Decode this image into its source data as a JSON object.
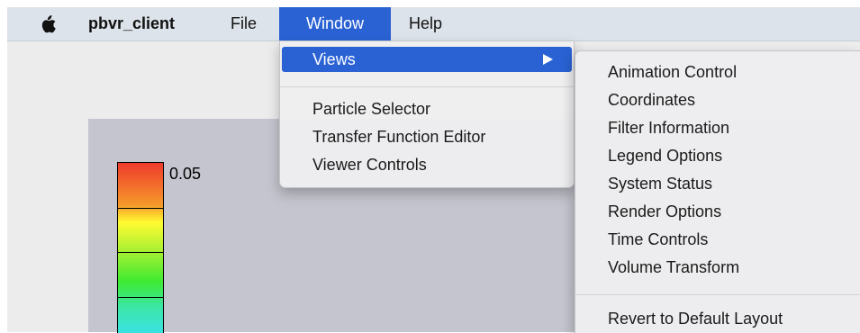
{
  "menubar": {
    "app_name": "pbvr_client",
    "file": "File",
    "window": "Window",
    "help": "Help"
  },
  "window_menu": {
    "views": "Views",
    "items": [
      "Particle Selector",
      "Transfer Function Editor",
      "Viewer Controls"
    ]
  },
  "views_submenu": {
    "items": [
      "Animation Control",
      "Coordinates",
      "Filter Information",
      "Legend Options",
      "System Status",
      "Render Options",
      "Time Controls",
      "Volume Transform"
    ],
    "revert": "Revert to Default Layout"
  },
  "legend": {
    "max_label": "0.05"
  },
  "colors": {
    "menu_highlight": "#2a62d4",
    "menubar_bg": "#dde3ea",
    "viewer_bg": "#c5c5cf"
  },
  "icons": {
    "apple": "apple-icon",
    "submenu_arrow": "triangle-right-icon"
  }
}
